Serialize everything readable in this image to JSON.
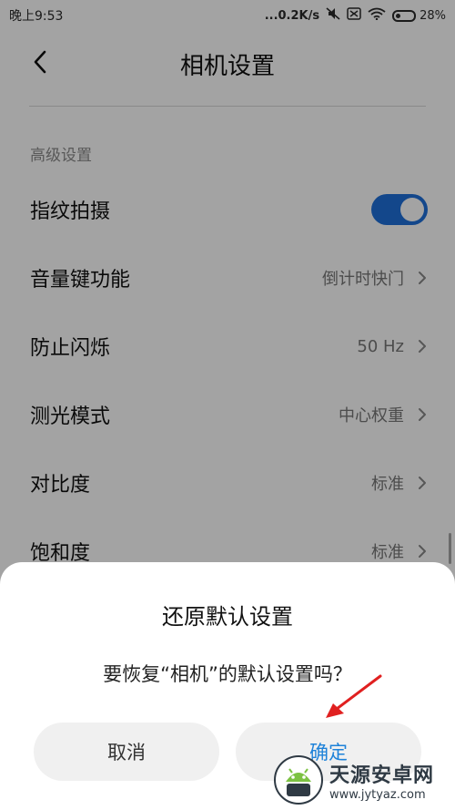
{
  "status_bar": {
    "time": "晚上9:53",
    "network_speed": "...0.2K/s",
    "battery_percent": "28%",
    "battery_level": 0.28,
    "icons": [
      "mute-icon",
      "sim-icon",
      "wifi-icon",
      "battery-icon"
    ]
  },
  "header": {
    "title": "相机设置",
    "back_icon": "chevron-left-icon"
  },
  "section": {
    "header": "高级设置"
  },
  "settings": [
    {
      "label": "指纹拍摄",
      "type": "toggle",
      "on": true
    },
    {
      "label": "音量键功能",
      "value": "倒计时快门"
    },
    {
      "label": "防止闪烁",
      "value": "50 Hz"
    },
    {
      "label": "测光模式",
      "value": "中心权重"
    },
    {
      "label": "对比度",
      "value": "标准"
    },
    {
      "label": "饱和度",
      "value": "标准"
    }
  ],
  "dialog": {
    "title": "还原默认设置",
    "message": "要恢复“相机”的默认设置吗？",
    "cancel_label": "取消",
    "confirm_label": "确定"
  },
  "annotation": {
    "arrow_color": "#e02020"
  },
  "watermark": {
    "name": "天源安卓网",
    "url": "www.jytyaz.com"
  },
  "colors": {
    "accent": "#1e6fd9",
    "confirm_text": "#1e82d9"
  }
}
